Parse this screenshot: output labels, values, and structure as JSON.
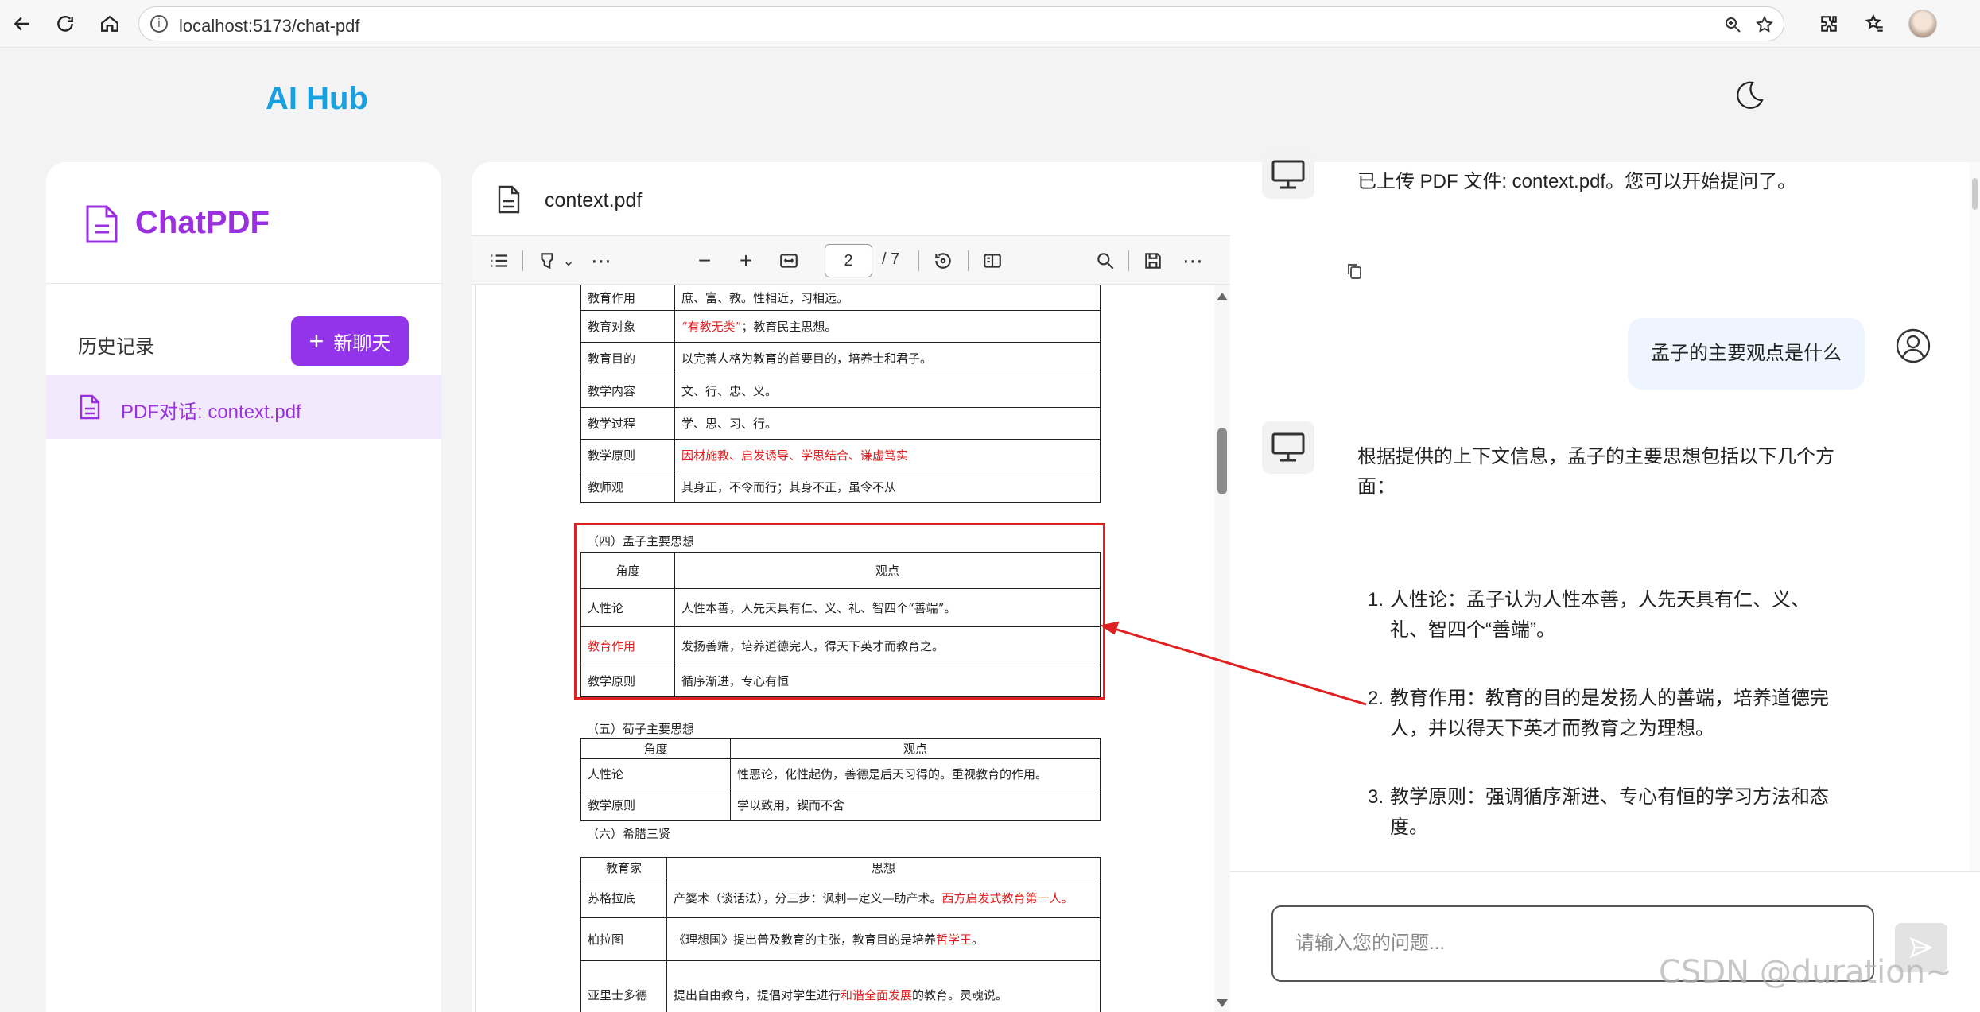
{
  "browser": {
    "url": "localhost:5173/chat-pdf",
    "info_icon": "i"
  },
  "app": {
    "brand": "AI Hub"
  },
  "sidebar": {
    "title": "ChatPDF",
    "history_label": "历史记录",
    "new_chat_plus": "+",
    "new_chat_label": "新聊天",
    "items": [
      {
        "label": "PDF对话: context.pdf"
      }
    ]
  },
  "pdf": {
    "filename": "context.pdf",
    "toolbar": {
      "minus": "−",
      "plus": "+",
      "page": "2",
      "total": "/ 7",
      "more": "⋯",
      "chevron": "⌄"
    },
    "table1": [
      {
        "k": "教育作用",
        "v": "庶、富、教。性相近，习相远。"
      },
      {
        "k": "教育对象",
        "v_red": "“有教无类”",
        "v": "；教育民主思想。"
      },
      {
        "k": "教育目的",
        "v": "以完善人格为教育的首要目的，培养士和君子。"
      },
      {
        "k": "教学内容",
        "v": "文、行、忠、义。"
      },
      {
        "k": "教学过程",
        "v": "学、思、习、行。"
      },
      {
        "k": "教学原则",
        "v_red": "因材施教、启发诱导、学思结合、谦虚笃实",
        "v": ""
      },
      {
        "k": "教师观",
        "v": "其身正，不令而行；其身不正，虽令不从"
      }
    ],
    "sec4_title": "（四）孟子主要思想",
    "table2_header": [
      "角度",
      "观点"
    ],
    "table2": [
      {
        "k": "人性论",
        "v": "人性本善，人先天具有仁、义、礼、智四个“善端”。"
      },
      {
        "k_red": "教育作用",
        "v": "发扬善端，培养道德完人，得天下英才而教育之。"
      },
      {
        "k": "教学原则",
        "v": "循序渐进，专心有恒"
      }
    ],
    "sec5_title": "（五）荀子主要思想",
    "table3_header": [
      "角度",
      "观点"
    ],
    "table3": [
      {
        "k": "人性论",
        "v": "性恶论，化性起伪，善德是后天习得的。重视教育的作用。"
      },
      {
        "k": "教学原则",
        "v": "学以致用，锲而不舍"
      }
    ],
    "sec6_title": "（六）希腊三贤",
    "table4_header": [
      "教育家",
      "思想"
    ],
    "table4": [
      {
        "k": "苏格拉底",
        "v": "产婆术（谈话法），分三步：讽刺—定义—助产术。",
        "v_red": "西方启发式教育第一人。"
      },
      {
        "k": "柏拉图",
        "v": "《理想国》提出普及教育的主张，教育目的是培养",
        "v_red": "哲学王",
        "v_tail": "。"
      },
      {
        "k": "亚里士多德",
        "v": "提出自由教育，提倡对学生进行",
        "v_red": "和谐全面发展",
        "v_tail": "的教育。灵魂说。"
      }
    ]
  },
  "chat": {
    "system_msg": "已上传 PDF 文件: context.pdf。您可以开始提问了。",
    "user_msg": "孟子的主要观点是什么",
    "answer_intro": "根据提供的上下文信息，孟子的主要思想包括以下几个方面：",
    "answer_items": [
      {
        "num": "1.",
        "text": "人性论：孟子认为人性本善，人先天具有仁、义、礼、智四个“善端”。"
      },
      {
        "num": "2.",
        "text": "教育作用：教育的目的是发扬人的善端，培养道德完人，并以得天下英才而教育之为理想。"
      },
      {
        "num": "3.",
        "text": "教学原则：强调循序渐进、专心有恒的学习方法和态度。"
      }
    ],
    "input_placeholder": "请输入您的问题..."
  },
  "watermark": "CSDN @duration~",
  "colors": {
    "brand": "#1aa0e0",
    "accent": "#9333ea",
    "highlight": "#e02020"
  }
}
